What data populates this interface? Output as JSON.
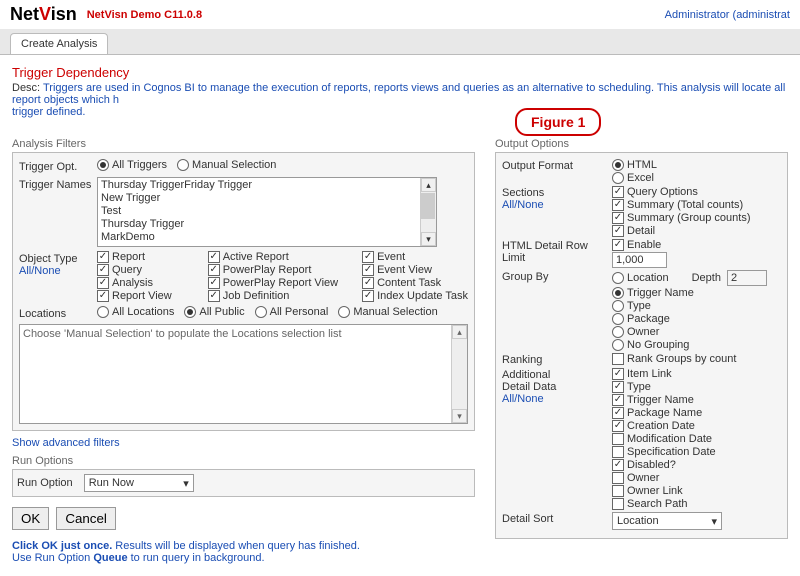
{
  "header": {
    "logo_net": "Net",
    "logo_v": "V",
    "logo_isn": "isn",
    "version": "NetVisn Demo C11.0.8",
    "admin": "Administrator (administrat"
  },
  "tab": {
    "label": "Create Analysis"
  },
  "figure": "Figure 1",
  "title": "Trigger Dependency",
  "desc_label": "Desc:",
  "desc_text": "Triggers are used in Cognos BI to manage the execution of reports, reports views and queries as an alternative to scheduling. This analysis will locate all report objects which h",
  "desc_text2": "trigger defined.",
  "filters": {
    "section": "Analysis Filters",
    "trigger_opt_label": "Trigger Opt.",
    "opt_all": "All Triggers",
    "opt_manual": "Manual Selection",
    "names_label": "Trigger Names",
    "names": [
      "Thursday TriggerFriday Trigger",
      "New Trigger",
      "Test",
      "Thursday Trigger",
      "MarkDemo"
    ],
    "obj_label": "Object Type",
    "allnone": "All/None",
    "obj_col1": [
      "Report",
      "Query",
      "Analysis",
      "Report View"
    ],
    "obj_col2": [
      "Active Report",
      "PowerPlay Report",
      "PowerPlay Report View",
      "Job Definition"
    ],
    "obj_col3": [
      "Event",
      "Event View",
      "Content Task",
      "Index Update Task"
    ],
    "loc_label": "Locations",
    "loc_all": "All Locations",
    "loc_pub": "All Public",
    "loc_pers": "All Personal",
    "loc_manual": "Manual Selection",
    "loc_placeholder": "Choose 'Manual Selection' to populate the Locations selection list",
    "advanced": "Show advanced filters"
  },
  "run": {
    "section": "Run Options",
    "label": "Run Option",
    "value": "Run Now",
    "ok": "OK",
    "cancel": "Cancel"
  },
  "footer": {
    "l1a": "Click OK just once.",
    "l1b": " Results will be displayed when query has finished.",
    "l2a": "Use Run Option ",
    "l2b": "Queue",
    "l2c": " to run query in background."
  },
  "output": {
    "section": "Output Options",
    "format_label": "Output Format",
    "html": "HTML",
    "excel": "Excel",
    "sections_label": "Sections",
    "sec_opts": [
      "Query Options",
      "Summary (Total counts)",
      "Summary (Group counts)",
      "Detail"
    ],
    "rowlimit_label": "HTML Detail Row Limit",
    "enable": "Enable",
    "limit_val": "1,000",
    "group_label": "Group By",
    "group_opts": [
      "Location",
      "Trigger Name",
      "Type",
      "Package",
      "Owner",
      "No Grouping"
    ],
    "depth_label": "Depth",
    "depth_val": "2",
    "rank_label": "Ranking",
    "rank_opt": "Rank Groups by count",
    "addl_label1": "Additional",
    "addl_label2": "Detail Data",
    "addl": [
      {
        "l": "Item Link",
        "c": true
      },
      {
        "l": "Type",
        "c": true
      },
      {
        "l": "Trigger Name",
        "c": true
      },
      {
        "l": "Package Name",
        "c": true
      },
      {
        "l": "Creation Date",
        "c": true
      },
      {
        "l": "Modification Date",
        "c": false
      },
      {
        "l": "Specification Date",
        "c": false
      },
      {
        "l": "Disabled?",
        "c": true
      },
      {
        "l": "Owner",
        "c": false
      },
      {
        "l": "Owner Link",
        "c": false
      },
      {
        "l": "Search Path",
        "c": false
      }
    ],
    "sort_label": "Detail Sort",
    "sort_val": "Location"
  }
}
